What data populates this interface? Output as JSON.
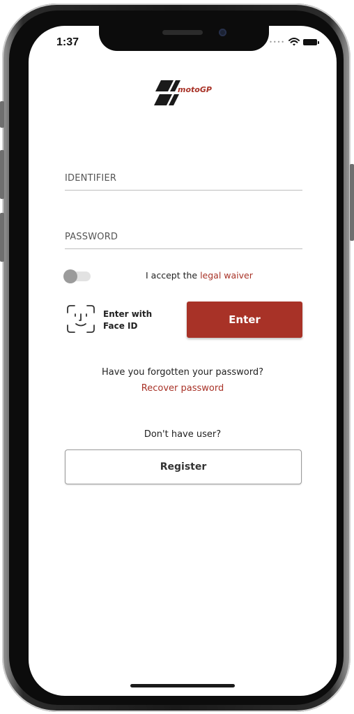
{
  "status_bar": {
    "time": "1:37",
    "signal_icon": "signal-dots-icon",
    "wifi_icon": "wifi-icon",
    "battery_icon": "battery-icon"
  },
  "brand": {
    "logo_text": "motoGP",
    "logo_icon": "motogp-logo",
    "accent_color": "#a83227"
  },
  "form": {
    "identifier_label": "IDENTIFIER",
    "password_label": "PASSWORD"
  },
  "waiver": {
    "prefix": "I accept the ",
    "link": "legal waiver",
    "toggle_on": false
  },
  "face_id": {
    "icon": "face-id-icon",
    "line1": "Enter with",
    "line2": "Face ID"
  },
  "enter_button": {
    "label": "Enter"
  },
  "forgot": {
    "question": "Have you forgotten your password?",
    "link": "Recover password"
  },
  "register": {
    "question": "Don't have user?",
    "button_label": "Register"
  }
}
